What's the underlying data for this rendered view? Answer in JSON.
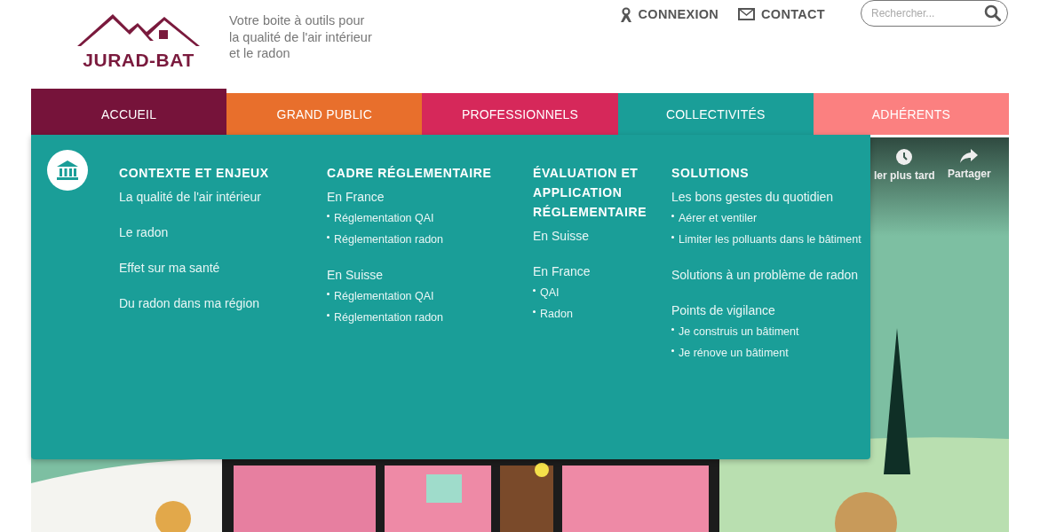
{
  "header": {
    "logo_text": "JURAD-BAT",
    "tagline": [
      "Votre boite à outils pour",
      "la qualité de l'air intérieur",
      "et le radon"
    ],
    "top_links": [
      {
        "label": "CONNEXION",
        "kind": "user"
      },
      {
        "label": "CONTACT",
        "kind": "mail"
      }
    ],
    "search": {
      "placeholder": "Rechercher..."
    }
  },
  "nav": {
    "tabs": [
      {
        "label": "ACCUEIL",
        "color": "#76133a",
        "selected": true
      },
      {
        "label": "GRAND PUBLIC",
        "color": "#e86f2c",
        "selected": false
      },
      {
        "label": "PROFESSIONNELS",
        "color": "#d6285a",
        "selected": false
      },
      {
        "label": "COLLECTIVITÉS",
        "color": "#1a9e98",
        "selected": false
      },
      {
        "label": "ADHÉRENTS",
        "color": "#fb8080",
        "selected": false
      }
    ]
  },
  "mega_menu": {
    "columns": [
      {
        "heading": "CONTEXTE ET ENJEUX",
        "groups": [
          {
            "label": "La qualité de l'air intérieur"
          },
          {
            "label": "Le radon"
          },
          {
            "label": "Effet sur ma santé"
          },
          {
            "label": "Du radon dans ma région"
          }
        ]
      },
      {
        "heading": "CADRE RÉGLEMENTAIRE",
        "groups": [
          {
            "label": "En France",
            "items": [
              "Réglementation QAI",
              "Réglementation radon"
            ]
          },
          {
            "label": "En Suisse",
            "items": [
              "Réglementation QAI",
              "Réglementation radon"
            ]
          }
        ]
      },
      {
        "heading": "ÉVALUATION ET APPLICATION RÉGLEMENTAIRE",
        "groups": [
          {
            "label": "En Suisse"
          },
          {
            "label": "En France",
            "items": [
              "QAI",
              "Radon"
            ]
          }
        ]
      },
      {
        "heading": "SOLUTIONS",
        "groups": [
          {
            "label": "Les bons gestes du quotidien",
            "items": [
              "Aérer et ventiler",
              "Limiter les polluants dans le bâtiment"
            ]
          },
          {
            "label": "Solutions à un problème de radon"
          },
          {
            "label": "Points de vigilance",
            "items": [
              "Je construis un bâtiment",
              "Je rénove un bâtiment"
            ]
          }
        ]
      }
    ]
  },
  "video": {
    "buttons": [
      {
        "label": "ler plus tard",
        "kind": "clock"
      },
      {
        "label": "Partager",
        "kind": "share"
      }
    ]
  }
}
